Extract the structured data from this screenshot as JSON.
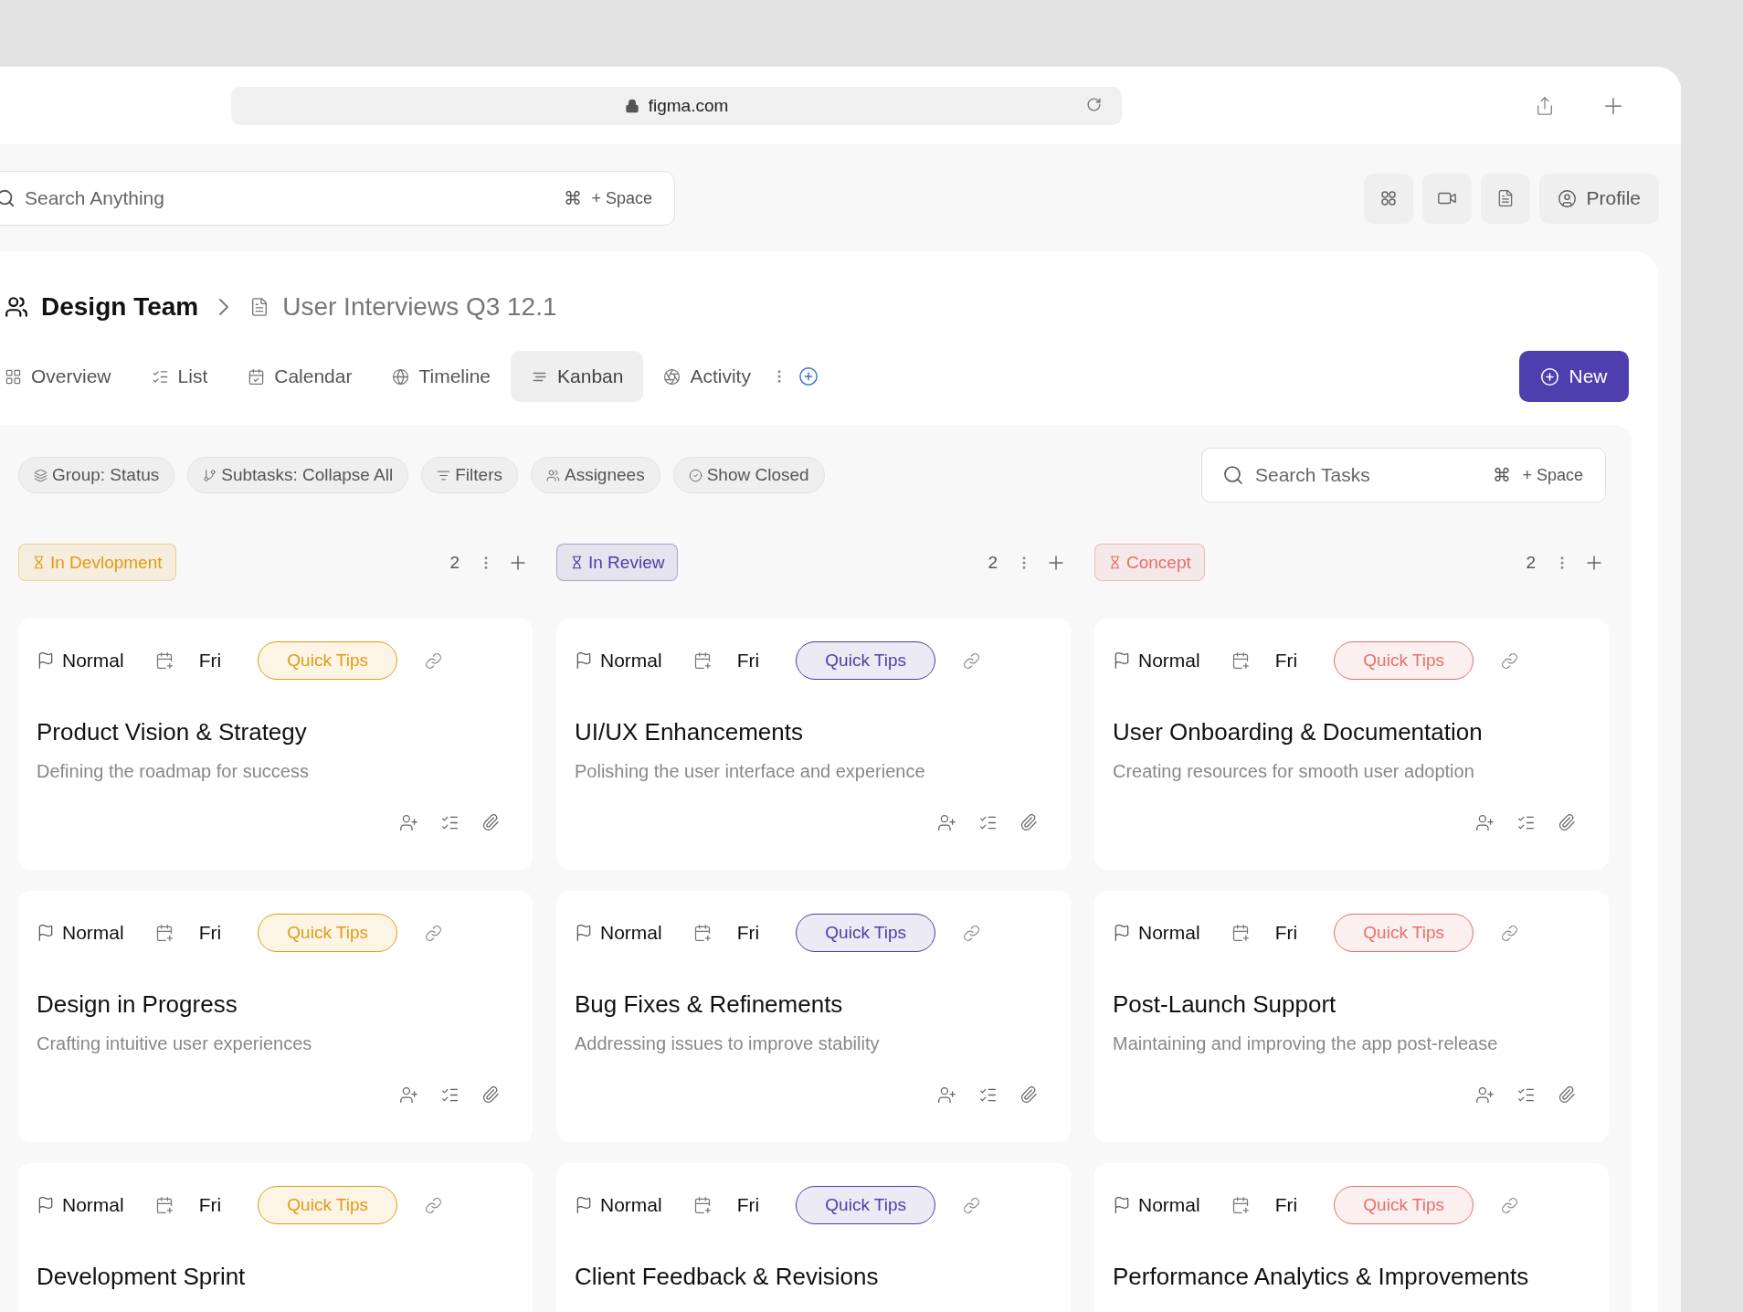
{
  "browser": {
    "url": "figma.com"
  },
  "topbar": {
    "search": {
      "placeholder": "Search Anything",
      "key": "⌘",
      "shortcut": "+ Space"
    },
    "profile": "Profile"
  },
  "breadcrumb": {
    "team": "Design Team",
    "page": "User Interviews Q3 12.1"
  },
  "tabs": [
    {
      "label": "Overview",
      "kind": "grid",
      "selected": false
    },
    {
      "label": "List",
      "kind": "list",
      "selected": false
    },
    {
      "label": "Calendar",
      "kind": "calendar",
      "selected": false
    },
    {
      "label": "Timeline",
      "kind": "globe",
      "selected": false
    },
    {
      "label": "Kanban",
      "kind": "kanban",
      "selected": true
    },
    {
      "label": "Activity",
      "kind": "activity",
      "selected": false
    }
  ],
  "new_button": "New",
  "filters": [
    {
      "label": "Group: Status",
      "kind": "layers"
    },
    {
      "label": "Subtasks: Collapse All",
      "kind": "branch"
    },
    {
      "label": "Filters",
      "kind": "filter"
    },
    {
      "label": "Assignees",
      "kind": "people"
    },
    {
      "label": "Show Closed",
      "kind": "check"
    }
  ],
  "task_search": {
    "placeholder": "Search Tasks",
    "key": "⌘",
    "shortcut": "+ Space"
  },
  "columns": [
    {
      "label": "In Devlopment",
      "count": "2",
      "color": "#e39b14",
      "cards": [
        {
          "priority": "Normal",
          "due": "Fri",
          "tag": "Quick Tips",
          "title": "Product Vision & Strategy",
          "description": "Defining the roadmap for success"
        },
        {
          "priority": "Normal",
          "due": "Fri",
          "tag": "Quick Tips",
          "title": "Design in Progress",
          "description": "Crafting intuitive user experiences"
        },
        {
          "priority": "Normal",
          "due": "Fri",
          "tag": "Quick Tips",
          "title": "Development Sprint"
        }
      ]
    },
    {
      "label": "In Review",
      "count": "2",
      "color": "#4b3fa6",
      "cards": [
        {
          "priority": "Normal",
          "due": "Fri",
          "tag": "Quick Tips",
          "title": "UI/UX Enhancements",
          "description": "Polishing the user interface and experience"
        },
        {
          "priority": "Normal",
          "due": "Fri",
          "tag": "Quick Tips",
          "title": "Bug Fixes & Refinements",
          "description": "Addressing issues to improve stability"
        },
        {
          "priority": "Normal",
          "due": "Fri",
          "tag": "Quick Tips",
          "title": "Client Feedback & Revisions"
        }
      ]
    },
    {
      "label": "Concept",
      "count": "2",
      "color": "#e5706a",
      "cards": [
        {
          "priority": "Normal",
          "due": "Fri",
          "tag": "Quick Tips",
          "title": "User Onboarding & Documentation",
          "description": "Creating resources for smooth user adoption"
        },
        {
          "priority": "Normal",
          "due": "Fri",
          "tag": "Quick Tips",
          "title": "Post-Launch Support",
          "description": "Maintaining and improving the app post-release"
        },
        {
          "priority": "Normal",
          "due": "Fri",
          "tag": "Quick Tips",
          "title": "Performance Analytics & Improvements"
        }
      ]
    }
  ]
}
